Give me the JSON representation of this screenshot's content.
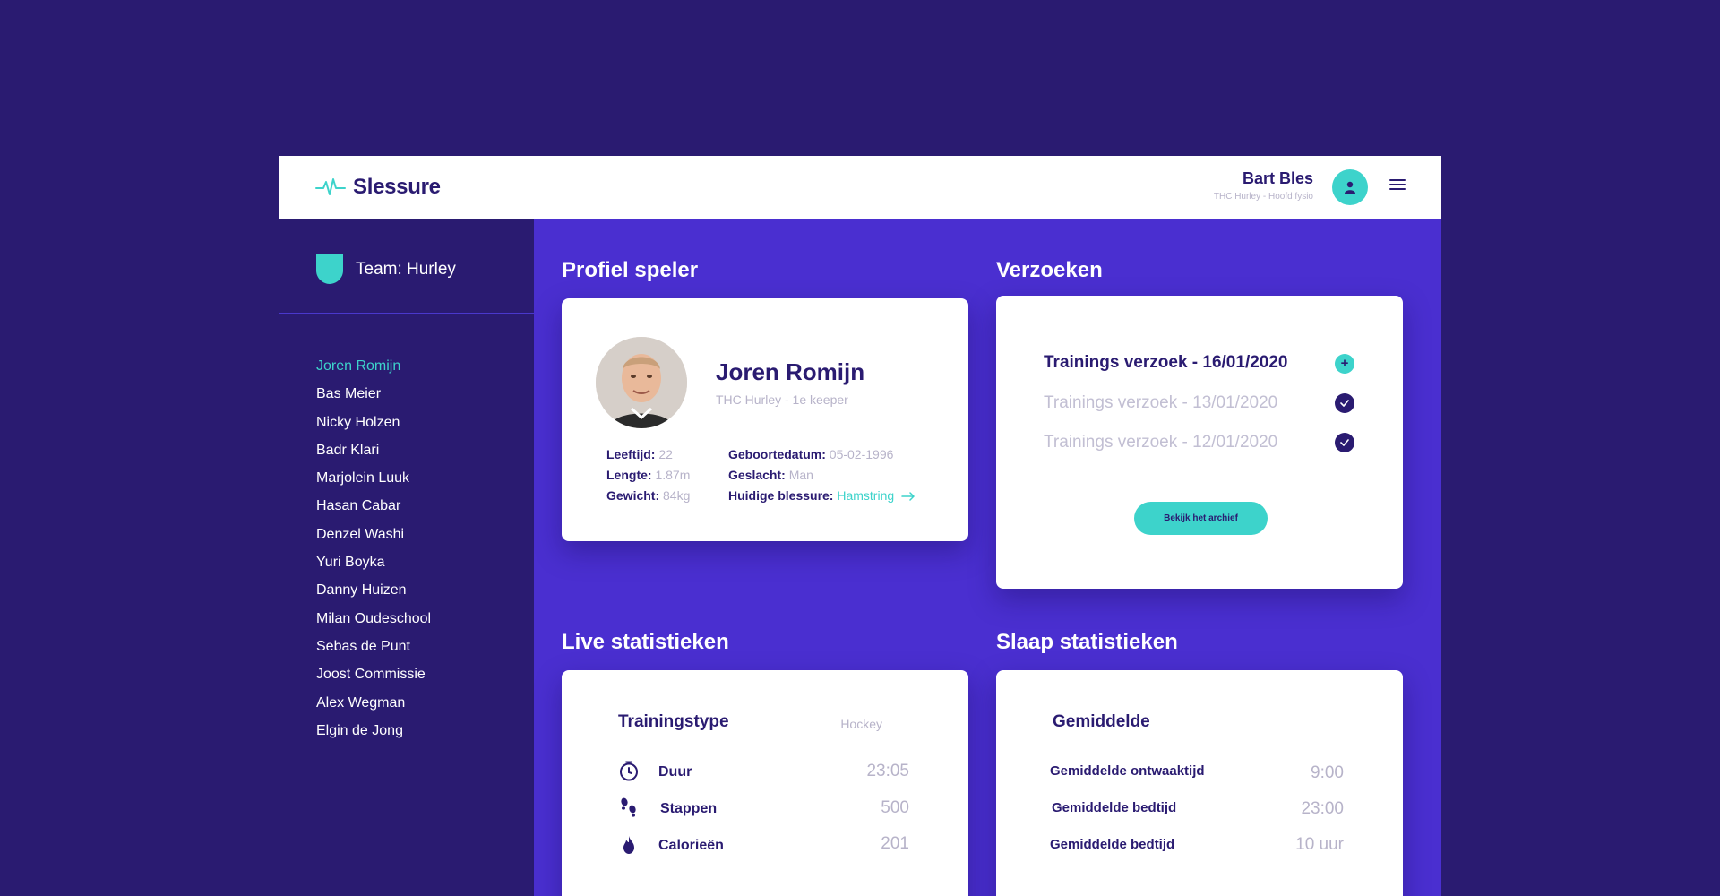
{
  "app": {
    "name": "Slessure"
  },
  "user": {
    "name": "Bart Bles",
    "role": "THC Hurley - Hoofd fysio"
  },
  "team": {
    "label": "Team: Hurley"
  },
  "players": [
    "Joren Romijn",
    "Bas Meier",
    "Nicky Holzen",
    "Badr Klari",
    "Marjolein  Luuk",
    "Hasan Cabar",
    "Denzel Washi",
    "Yuri Boyka",
    "Danny Huizen",
    "Milan Oudeschool",
    "Sebas de Punt",
    "Joost Commissie",
    "Alex Wegman",
    "Elgin de Jong"
  ],
  "profile": {
    "section_title": "Profiel speler",
    "name": "Joren Romijn",
    "subtitle": "THC Hurley - 1e keeper",
    "age_label": "Leeftijd:",
    "age": "22",
    "height_label": "Lengte:",
    "height": "1.87m",
    "weight_label": "Gewicht:",
    "weight": "84kg",
    "dob_label": "Geboortedatum:",
    "dob": "05-02-1996",
    "gender_label": "Geslacht:",
    "gender": "Man",
    "injury_label": "Huidige blessure:",
    "injury": "Hamstring"
  },
  "requests": {
    "section_title": "Verzoeken",
    "items": [
      {
        "label": "Trainings verzoek - 16/01/2020",
        "status": "open"
      },
      {
        "label": "Trainings verzoek - 13/01/2020",
        "status": "done"
      },
      {
        "label": "Trainings verzoek - 12/01/2020",
        "status": "done"
      }
    ],
    "open_icon": "+",
    "archive_button": "Bekijk het archief"
  },
  "live": {
    "section_title": "Live statistieken",
    "title": "Trainingstype",
    "type": "Hockey",
    "rows": [
      {
        "icon": "stopwatch-icon",
        "label": "Duur",
        "value": "23:05"
      },
      {
        "icon": "footsteps-icon",
        "label": "Stappen",
        "value": "500"
      },
      {
        "icon": "flame-icon",
        "label": "Calorieën",
        "value": "201"
      }
    ]
  },
  "sleep": {
    "section_title": "Slaap statistieken",
    "title": "Gemiddelde",
    "rows": [
      {
        "label": "Gemiddelde ontwaaktijd",
        "value": "9:00"
      },
      {
        "label": "Gemiddelde bedtijd",
        "value": "23:00"
      },
      {
        "label": "Gemiddelde bedtijd",
        "value": "10 uur"
      }
    ]
  },
  "colors": {
    "background": "#2a1b71",
    "main": "#4a2fd0",
    "accent": "#3dd3cb",
    "text_dark": "#2a1b71",
    "muted": "#b7b3c9"
  }
}
